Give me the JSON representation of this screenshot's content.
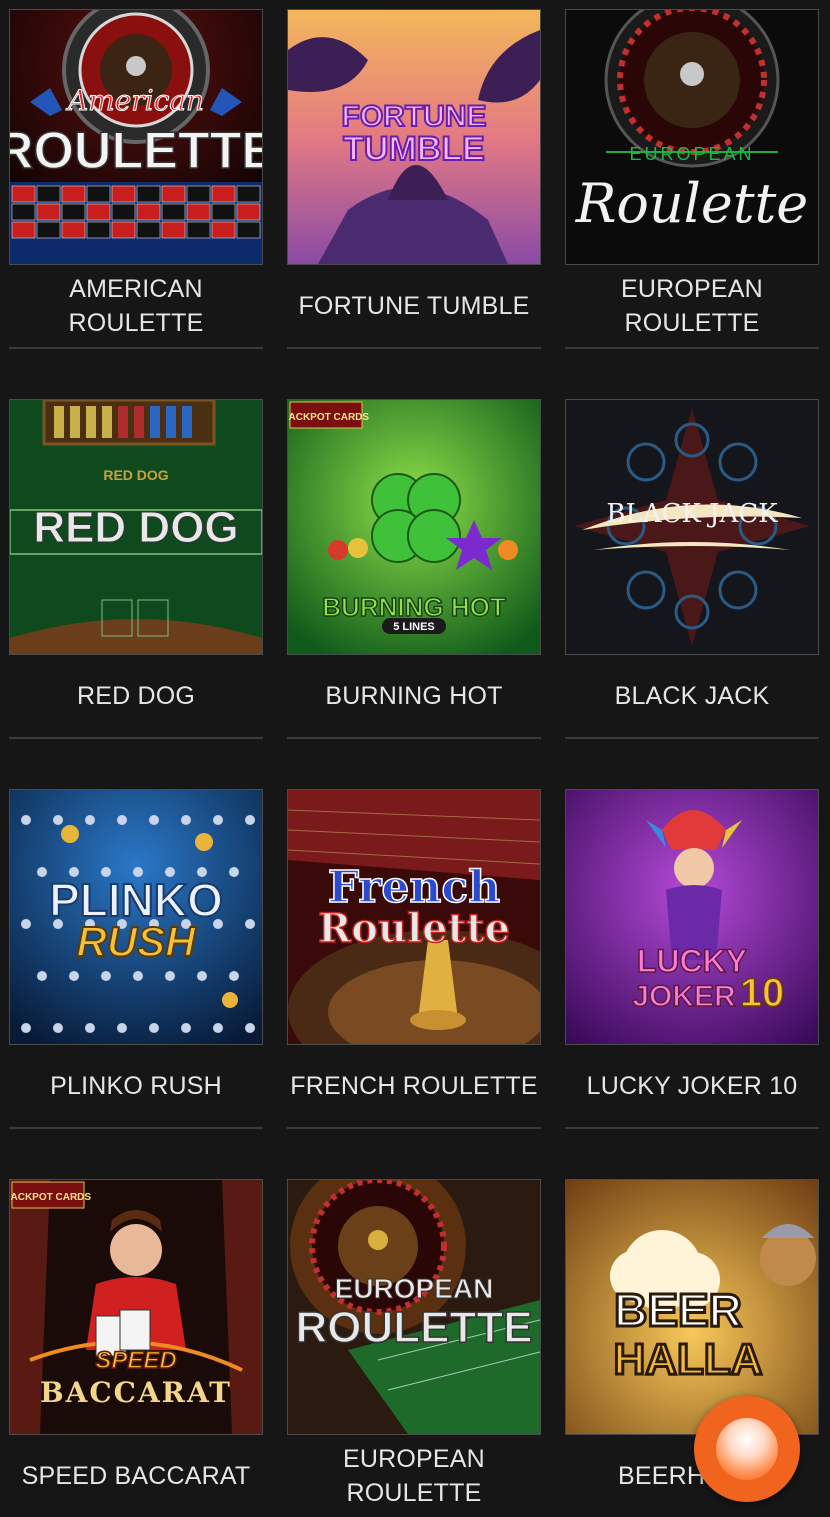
{
  "games": [
    {
      "title": "AMERICAN ROULETTE",
      "art": "American ROULETTE"
    },
    {
      "title": "FORTUNE TUMBLE",
      "art": "FORTUNE TUMBLE"
    },
    {
      "title": "EUROPEAN ROULETTE",
      "art": "EUROPEAN Roulette"
    },
    {
      "title": "RED DOG",
      "art": "RED DOG"
    },
    {
      "title": "BURNING HOT",
      "art": "BURNING HOT",
      "badge": "5 LINES",
      "corner": "JACKPOT CARDS"
    },
    {
      "title": "BLACK JACK",
      "art": "BLACK JACK"
    },
    {
      "title": "PLINKO RUSH",
      "art": "PLINKO RUSH"
    },
    {
      "title": "FRENCH ROULETTE",
      "art": "French Roulette"
    },
    {
      "title": "LUCKY JOKER 10",
      "art": "LUCKY JOKER 10"
    },
    {
      "title": "SPEED BACCARAT",
      "art": "SPEED BACCARAT",
      "corner": "JACKPOT CARDS"
    },
    {
      "title": "EUROPEAN ROULETTE",
      "art": "EUROPEAN ROULETTE"
    },
    {
      "title": "BEERHALLA",
      "art": "BEER HALLA",
      "visible_label": "BEERH"
    }
  ],
  "chat_button": {
    "icon": "chat-bubble-icon",
    "color": "#f0641e"
  },
  "colors": {
    "background": "#161616",
    "label": "#e6e6e6",
    "divider": "#3a3a3a"
  }
}
